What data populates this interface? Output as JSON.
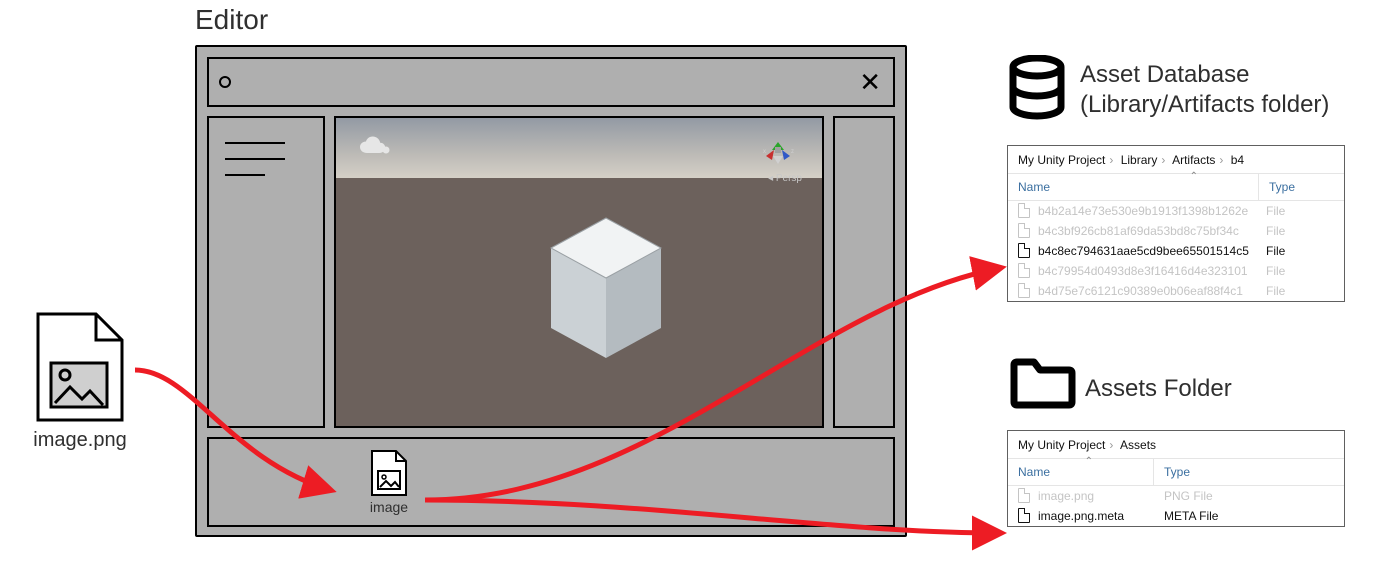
{
  "editor": {
    "title": "Editor",
    "persp_label": "Persp",
    "asset_chip_label": "image"
  },
  "source_file": {
    "label": "image.png"
  },
  "asset_database": {
    "title_line1": "Asset Database",
    "title_line2": "(Library/Artifacts folder)",
    "breadcrumb": [
      "My Unity Project",
      "Library",
      "Artifacts",
      "b4"
    ],
    "headers": {
      "name": "Name",
      "type": "Type"
    },
    "rows": [
      {
        "name": "b4b2a14e73e530e9b1913f1398b1262e",
        "type": "File",
        "active": false
      },
      {
        "name": "b4c3bf926cb81af69da53bd8c75bf34c",
        "type": "File",
        "active": false
      },
      {
        "name": "b4c8ec794631aae5cd9bee65501514c5",
        "type": "File",
        "active": true
      },
      {
        "name": "b4c79954d0493d8e3f16416d4e323101",
        "type": "File",
        "active": false
      },
      {
        "name": "b4d75e7c6121c90389e0b06eaf88f4c1",
        "type": "File",
        "active": false
      }
    ]
  },
  "assets_folder": {
    "title": "Assets Folder",
    "breadcrumb": [
      "My Unity Project",
      "Assets"
    ],
    "headers": {
      "name": "Name",
      "type": "Type"
    },
    "rows": [
      {
        "name": "image.png",
        "type": "PNG File",
        "active": false
      },
      {
        "name": "image.png.meta",
        "type": "META File",
        "active": true
      }
    ]
  }
}
